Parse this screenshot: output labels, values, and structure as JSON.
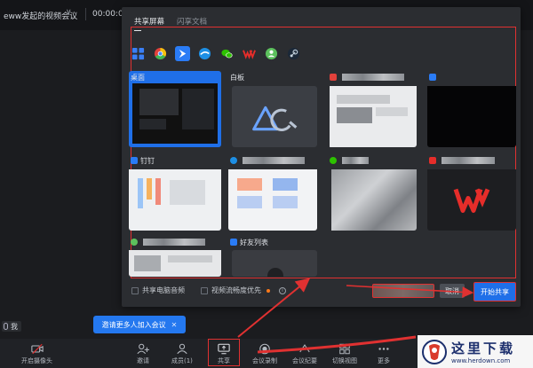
{
  "meeting": {
    "title": "eww发起的视频会议",
    "time": "00:00:08",
    "me_label": "我"
  },
  "share_dialog": {
    "tabs": [
      {
        "label": "共享屏幕",
        "active": true
      },
      {
        "label": "闪享文档",
        "active": false
      }
    ],
    "apps": [
      {
        "icon": "grid-icon",
        "color": "#3a7ff6"
      },
      {
        "icon": "chrome-icon",
        "color": "#e2413b"
      },
      {
        "icon": "feishu-icon",
        "color": "#2a7cf6"
      },
      {
        "icon": "browser-icon",
        "color": "#1d8fe4"
      },
      {
        "icon": "wechat-icon",
        "color": "#2dc100"
      },
      {
        "icon": "wps-icon",
        "color": "#e62d2a"
      },
      {
        "icon": "emoji-app-icon",
        "color": "#5cc15d"
      },
      {
        "icon": "steam-icon",
        "color": "#1b2838"
      }
    ],
    "cards": [
      {
        "label": "桌面"
      },
      {
        "label": "白板"
      },
      {
        "label": ""
      },
      {
        "label": ""
      },
      {
        "label": "钉钉"
      },
      {
        "label": ""
      },
      {
        "label": ""
      },
      {
        "label": ""
      },
      {
        "label": ""
      },
      {
        "label": "好友列表"
      }
    ],
    "options": {
      "share_audio": "共享电脑音频",
      "video_smooth": "视频流畅度优先"
    },
    "buttons": {
      "cancel": "取消",
      "start": "开始共享"
    }
  },
  "invite_tip": "邀请更多人加入会议",
  "toolbar": [
    {
      "label": "开启摄像头",
      "icon": "camera-off-icon"
    },
    {
      "label": "邀请",
      "icon": "invite-icon"
    },
    {
      "label": "成员(1)",
      "icon": "members-icon"
    },
    {
      "label": "共享",
      "icon": "share-screen-icon"
    },
    {
      "label": "会议录制",
      "icon": "record-icon"
    },
    {
      "label": "会议纪要",
      "icon": "minutes-icon"
    },
    {
      "label": "切换视图",
      "icon": "view-switch-icon"
    },
    {
      "label": "更多",
      "icon": "more-icon"
    }
  ],
  "watermark": {
    "name": "这里下载",
    "url": "www.herdown.com"
  }
}
